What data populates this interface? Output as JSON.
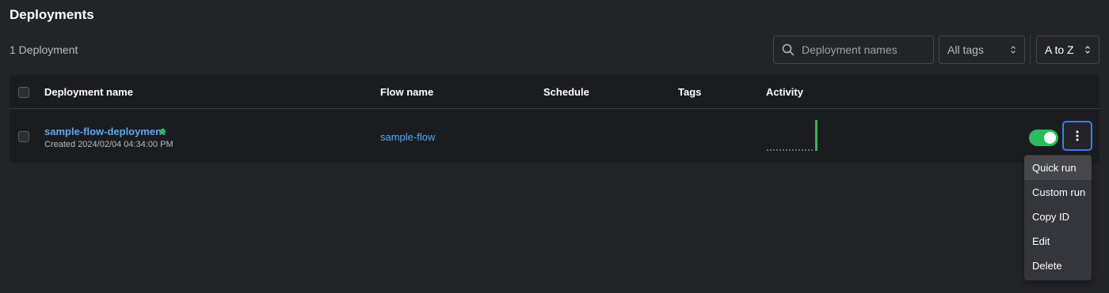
{
  "header": {
    "title": "Deployments",
    "count_label": "1 Deployment"
  },
  "toolbar": {
    "search_placeholder": "Deployment names",
    "tags_select": "All tags",
    "sort_select": "A to Z"
  },
  "table": {
    "columns": [
      "Deployment name",
      "Flow name",
      "Schedule",
      "Tags",
      "Activity"
    ],
    "rows": [
      {
        "deployment_name": "sample-flow-deployment",
        "created": "Created 2024/02/04 04:34:00 PM",
        "flow_name": "sample-flow",
        "schedule": "",
        "tags": "",
        "status": "ready",
        "enabled": true
      }
    ]
  },
  "menu": {
    "items": [
      "Quick run",
      "Custom run",
      "Copy ID",
      "Edit",
      "Delete"
    ],
    "highlighted": "Quick run"
  },
  "colors": {
    "background": "#232427",
    "table_bg": "#1b1c1f",
    "link": "#5aa9f5",
    "success": "#2bbd5c",
    "focus": "#3d7cf0",
    "menu_bg": "#35363b"
  },
  "icons": [
    "search-icon",
    "chevron-up-down-icon",
    "more-vertical-icon"
  ]
}
